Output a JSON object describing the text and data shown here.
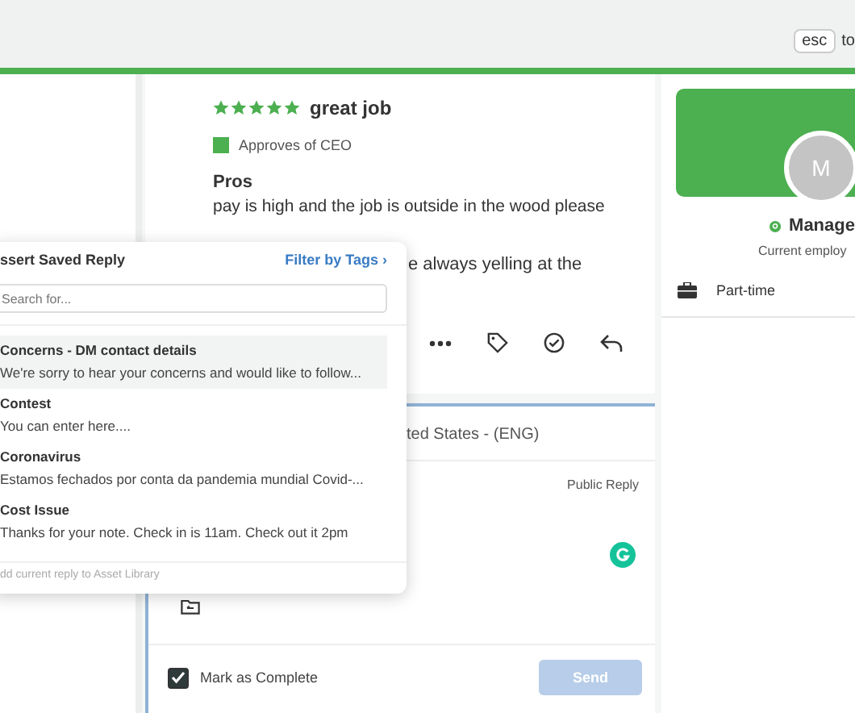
{
  "topbar": {
    "key_hint": "esc",
    "hint_text": "to"
  },
  "review": {
    "stars": 5,
    "title": "great job",
    "approval": {
      "approves": true,
      "label": "Approves of CEO"
    },
    "pros_heading": "Pros",
    "pros_text": "pay is high and the job is outside in the wood please",
    "cons_fragment": "e always yelling at the"
  },
  "composer": {
    "language": "ted States - (ENG)",
    "reply_type": "Public Reply",
    "mark_complete": {
      "label": "Mark as Complete",
      "checked": true
    },
    "send_button": {
      "label": "Send",
      "disabled": true
    }
  },
  "saved_reply_popup": {
    "title": "ssert Saved Reply",
    "filter_link": "Filter by Tags ›",
    "search": {
      "placeholder": "Search for..."
    },
    "items": [
      {
        "title": "Concerns - DM contact details",
        "preview": "We're sorry to hear your concerns and would like to follow...",
        "selected": true
      },
      {
        "title": "Contest",
        "preview": "You can enter here....",
        "selected": false
      },
      {
        "title": "Coronavirus",
        "preview": "Estamos fechados por conta da pandemia mundial Covid-...",
        "selected": false
      },
      {
        "title": "Cost Issue",
        "preview": "Thanks for your note. Check in is 11am. Check out it 2pm",
        "selected": false
      }
    ],
    "footer": "dd current reply to Asset Library"
  },
  "profile": {
    "avatar_initial": "M",
    "name": "Manage",
    "status": "Current employ",
    "employment": "Part-time"
  }
}
